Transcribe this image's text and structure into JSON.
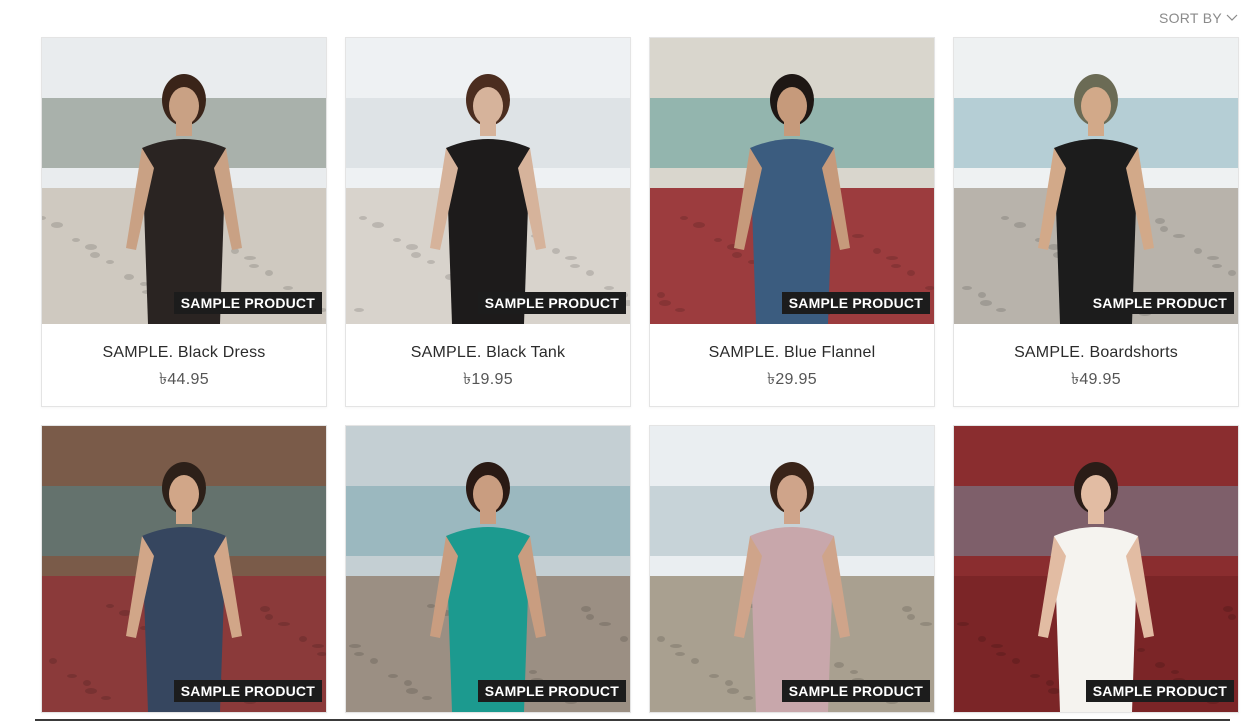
{
  "toolbar": {
    "sort_label": "SORT BY"
  },
  "products": [
    {
      "name": "SAMPLE. Black Dress",
      "price": "৳44.95",
      "badge": "SAMPLE PRODUCT",
      "scene": {
        "sky": "#e9ecee",
        "ground": "#cfc9c0",
        "accent": "#5b6a59",
        "figure": "#2a2422",
        "skin": "#c9a184",
        "hair": "#3a2419"
      }
    },
    {
      "name": "SAMPLE. Black Tank",
      "price": "৳19.95",
      "badge": "SAMPLE PRODUCT",
      "scene": {
        "sky": "#eef1f3",
        "ground": "#d8d3cc",
        "accent": "#c9d2d6",
        "figure": "#1d1b1b",
        "skin": "#d6b39b",
        "hair": "#4b2d1f"
      }
    },
    {
      "name": "SAMPLE. Blue Flannel",
      "price": "৳29.95",
      "badge": "SAMPLE PRODUCT",
      "scene": {
        "sky": "#d9d6cd",
        "ground": "#9c3c3e",
        "accent": "#3f8d8a",
        "figure": "#3b5c7f",
        "skin": "#c69a7b",
        "hair": "#1e1714"
      }
    },
    {
      "name": "SAMPLE. Boardshorts",
      "price": "৳49.95",
      "badge": "SAMPLE PRODUCT",
      "scene": {
        "sky": "#eef1f2",
        "ground": "#b8b3ab",
        "accent": "#6fa3b2",
        "figure": "#1c1c1c",
        "skin": "#d2a989",
        "hair": "#6b6b55"
      }
    },
    {
      "name": "",
      "price": "",
      "badge": "SAMPLE PRODUCT",
      "scene": {
        "sky": "#7a5b49",
        "ground": "#8b3a3a",
        "accent": "#4a8d9a",
        "figure": "#36465f",
        "skin": "#d1a688",
        "hair": "#2d2019"
      }
    },
    {
      "name": "",
      "price": "",
      "badge": "SAMPLE PRODUCT",
      "scene": {
        "sky": "#c4cfd3",
        "ground": "#9b8f83",
        "accent": "#6b9ba6",
        "figure": "#1c9a8f",
        "skin": "#c99d80",
        "hair": "#2a1a14"
      }
    },
    {
      "name": "",
      "price": "",
      "badge": "SAMPLE PRODUCT",
      "scene": {
        "sky": "#eaeef1",
        "ground": "#a9a090",
        "accent": "#9db1bb",
        "figure": "#c8a7ab",
        "skin": "#cfa48a",
        "hair": "#3a2419"
      }
    },
    {
      "name": "",
      "price": "",
      "badge": "SAMPLE PRODUCT",
      "scene": {
        "sky": "#8a2d2f",
        "ground": "#7b2527",
        "accent": "#6f9db4",
        "figure": "#f5f3ef",
        "skin": "#e2bca3",
        "hair": "#2a1c17"
      }
    }
  ]
}
